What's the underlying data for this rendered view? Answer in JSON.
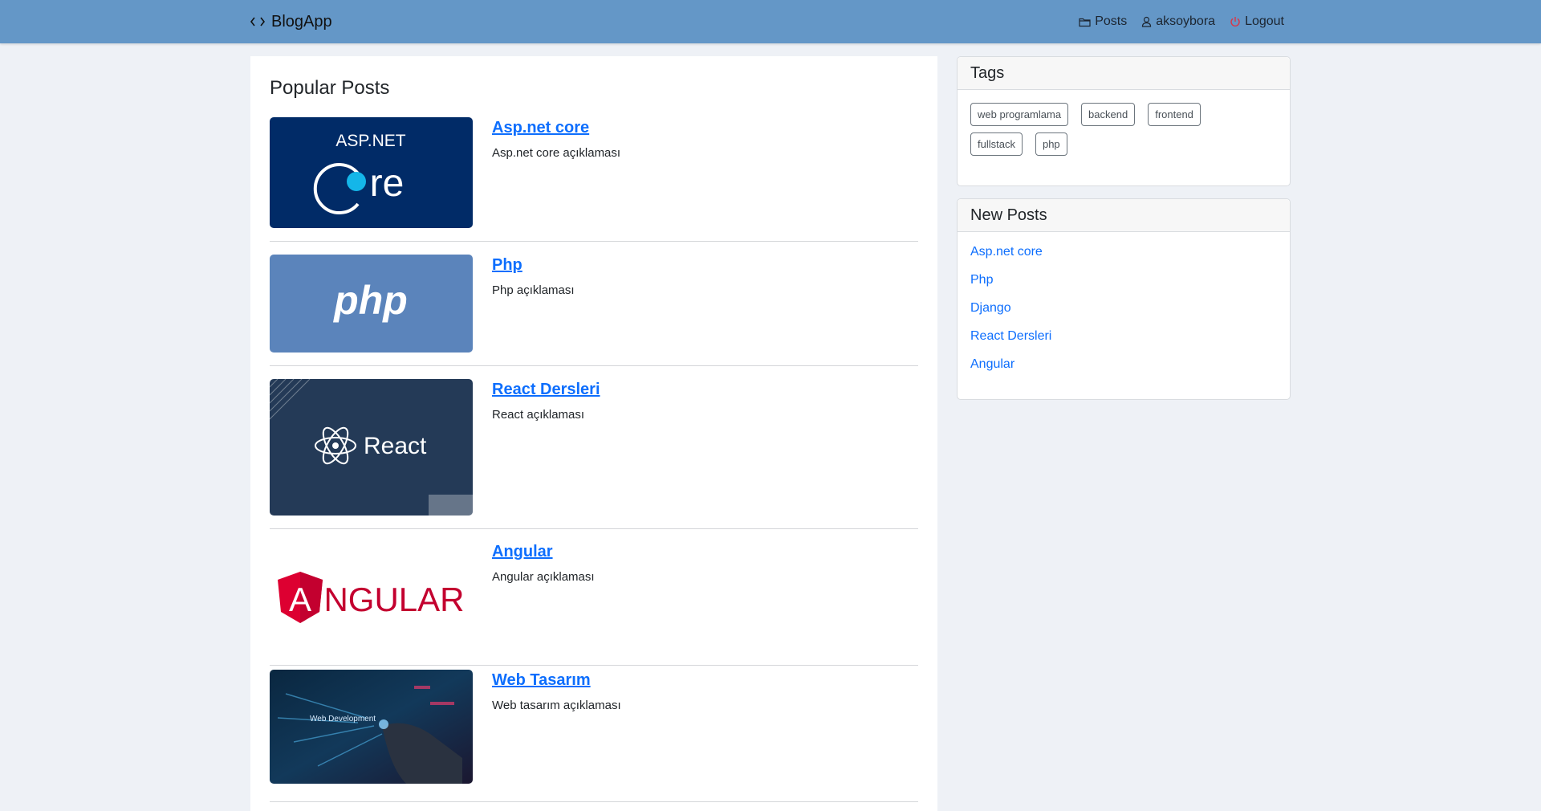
{
  "navbar": {
    "brand_icon": "code-icon",
    "brand": "BlogApp",
    "links": [
      {
        "icon": "folder-icon",
        "label": "Posts"
      },
      {
        "icon": "user-icon",
        "label": "aksoybora"
      },
      {
        "icon": "power-icon",
        "label": "Logout"
      }
    ],
    "background": "#6497c7"
  },
  "main": {
    "title": "Popular Posts",
    "posts": [
      {
        "title": "Asp.net core",
        "description": "Asp.net core açıklaması",
        "thumb_text": "ASP.NET",
        "thumb_logo": "re"
      },
      {
        "title": "Php",
        "description": "Php açıklaması",
        "thumb_text": "php"
      },
      {
        "title": "React Dersleri",
        "description": "React açıklaması",
        "thumb_text": "React"
      },
      {
        "title": "Angular",
        "description": "Angular açıklaması",
        "thumb_text": "NGULAR",
        "thumb_letter": "A"
      },
      {
        "title": "Web Tasarım",
        "description": "Web tasarım açıklaması",
        "thumb_text": "Web Development"
      }
    ]
  },
  "sidebar": {
    "tags": {
      "title": "Tags",
      "items": [
        "web programlama",
        "backend",
        "frontend",
        "fullstack",
        "php"
      ]
    },
    "new_posts": {
      "title": "New Posts",
      "items": [
        "Asp.net core",
        "Php",
        "Django",
        "React Dersleri",
        "Angular"
      ]
    }
  },
  "colors": {
    "link": "#0d6efd",
    "logout_icon": "#dc3545"
  }
}
